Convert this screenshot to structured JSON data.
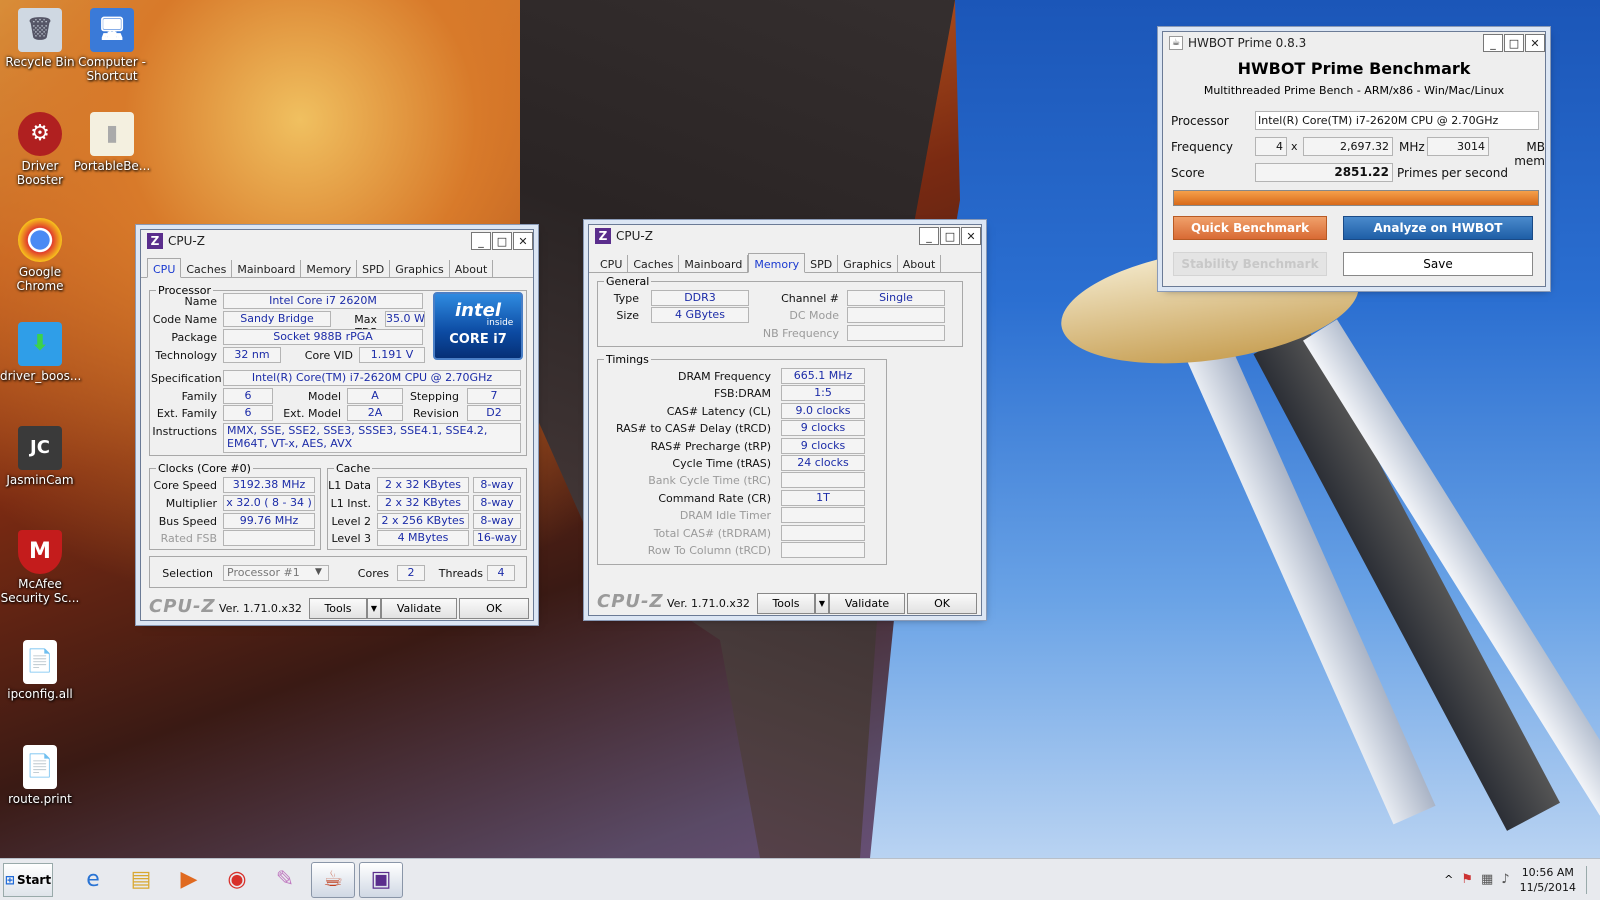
{
  "desktop_icons": [
    {
      "name": "recycle-bin",
      "label": "Recycle Bin",
      "glyph": "🗑",
      "x": 0
    },
    {
      "name": "computer-shortcut",
      "label": "Computer - Shortcut",
      "glyph": "🖥"
    },
    {
      "name": "driver-booster",
      "label": "Driver Booster",
      "glyph": "⚙"
    },
    {
      "name": "portable",
      "label": "PortableBe...",
      "glyph": "▮"
    },
    {
      "name": "google-chrome",
      "label": "Google Chrome",
      "glyph": "◉"
    },
    {
      "name": "driver-boos",
      "label": "driver_boos...",
      "glyph": "⬇"
    },
    {
      "name": "jasmincam",
      "label": "JasminCam",
      "glyph": "JC"
    },
    {
      "name": "mcafee",
      "label": "McAfee Security Sc...",
      "glyph": "M"
    },
    {
      "name": "ipconfig",
      "label": "ipconfig.all",
      "glyph": "📄"
    },
    {
      "name": "route",
      "label": "route.print",
      "glyph": "📄"
    }
  ],
  "cpuz1": {
    "title": "CPU-Z",
    "tabs": [
      "CPU",
      "Caches",
      "Mainboard",
      "Memory",
      "SPD",
      "Graphics",
      "About"
    ],
    "processor_legend": "Processor",
    "name_label": "Name",
    "name": "Intel Core i7 2620M",
    "codename_label": "Code Name",
    "codename": "Sandy Bridge",
    "tdp_label": "Max TDP",
    "tdp": "35.0 W",
    "package_label": "Package",
    "package": "Socket 988B rPGA",
    "tech_label": "Technology",
    "tech": "32 nm",
    "vid_label": "Core VID",
    "vid": "1.191 V",
    "spec_label": "Specification",
    "spec": "Intel(R) Core(TM) i7-2620M CPU @ 2.70GHz",
    "family_label": "Family",
    "family": "6",
    "model_label": "Model",
    "model": "A",
    "stepping_label": "Stepping",
    "stepping": "7",
    "extfamily_label": "Ext. Family",
    "extfamily": "6",
    "extmodel_label": "Ext. Model",
    "extmodel": "2A",
    "revision_label": "Revision",
    "revision": "D2",
    "instr_label": "Instructions",
    "instr": "MMX, SSE, SSE2, SSE3, SSSE3, SSE4.1, SSE4.2, EM64T, VT-x, AES, AVX",
    "clocks_legend": "Clocks (Core #0)",
    "corespeed_label": "Core Speed",
    "corespeed": "3192.38 MHz",
    "mult_label": "Multiplier",
    "mult": "x 32.0 ( 8 - 34 )",
    "bus_label": "Bus Speed",
    "bus": "99.76 MHz",
    "fsb_label": "Rated FSB",
    "fsb": "",
    "cache_legend": "Cache",
    "l1d_label": "L1 Data",
    "l1d": "2 x 32 KBytes",
    "l1d_way": "8-way",
    "l1i_label": "L1 Inst.",
    "l1i": "2 x 32 KBytes",
    "l1i_way": "8-way",
    "l2_label": "Level 2",
    "l2": "2 x 256 KBytes",
    "l2_way": "8-way",
    "l3_label": "Level 3",
    "l3": "4 MBytes",
    "l3_way": "16-way",
    "sel_label": "Selection",
    "sel": "Processor #1",
    "cores_label": "Cores",
    "cores": "2",
    "threads_label": "Threads",
    "threads": "4",
    "logo": "CPU-Z",
    "ver": "Ver. 1.71.0.x32",
    "tools": "Tools",
    "validate": "Validate",
    "ok": "OK",
    "intel_inside": "intel",
    "inside": "inside",
    "core": "CORE i7"
  },
  "cpuz2": {
    "title": "CPU-Z",
    "tabs": [
      "CPU",
      "Caches",
      "Mainboard",
      "Memory",
      "SPD",
      "Graphics",
      "About"
    ],
    "general_legend": "General",
    "type_label": "Type",
    "type": "DDR3",
    "size_label": "Size",
    "size": "4 GBytes",
    "channel_label": "Channel #",
    "channel": "Single",
    "dcmode_label": "DC Mode",
    "dcmode": "",
    "nbfreq_label": "NB Frequency",
    "nbfreq": "",
    "timings_legend": "Timings",
    "timings": [
      {
        "label": "DRAM Frequency",
        "value": "665.1 MHz",
        "dim": false
      },
      {
        "label": "FSB:DRAM",
        "value": "1:5",
        "dim": false
      },
      {
        "label": "CAS# Latency (CL)",
        "value": "9.0 clocks",
        "dim": false
      },
      {
        "label": "RAS# to CAS# Delay (tRCD)",
        "value": "9 clocks",
        "dim": false
      },
      {
        "label": "RAS# Precharge (tRP)",
        "value": "9 clocks",
        "dim": false
      },
      {
        "label": "Cycle Time (tRAS)",
        "value": "24 clocks",
        "dim": false
      },
      {
        "label": "Bank Cycle Time (tRC)",
        "value": "",
        "dim": true
      },
      {
        "label": "Command Rate (CR)",
        "value": "1T",
        "dim": false
      },
      {
        "label": "DRAM Idle Timer",
        "value": "",
        "dim": true
      },
      {
        "label": "Total CAS# (tRDRAM)",
        "value": "",
        "dim": true
      },
      {
        "label": "Row To Column (tRCD)",
        "value": "",
        "dim": true
      }
    ],
    "logo": "CPU-Z",
    "ver": "Ver. 1.71.0.x32",
    "tools": "Tools",
    "validate": "Validate",
    "ok": "OK"
  },
  "hwbot": {
    "title": "HWBOT Prime 0.8.3",
    "heading": "HWBOT Prime Benchmark",
    "subheading": "Multithreaded Prime Bench - ARM/x86 - Win/Mac/Linux",
    "processor_label": "Processor",
    "processor": "Intel(R) Core(TM) i7-2620M CPU @ 2.70GHz",
    "frequency_label": "Frequency",
    "threads": "4",
    "x": "x",
    "mhz_value": "2,697.32",
    "mhz": "MHz",
    "mem_value": "3014",
    "mem": "MB mem",
    "score_label": "Score",
    "score": "2851.22",
    "primes": "Primes per second",
    "progress": 1.0,
    "quick": "Quick Benchmark",
    "analyze": "Analyze on HWBOT",
    "stability": "Stability Benchmark",
    "save": "Save",
    "accent": "#e07a2e",
    "blue": "#2a6db0"
  },
  "taskbar": {
    "start": "Start",
    "time": "10:56 AM",
    "date": "11/5/2014"
  }
}
